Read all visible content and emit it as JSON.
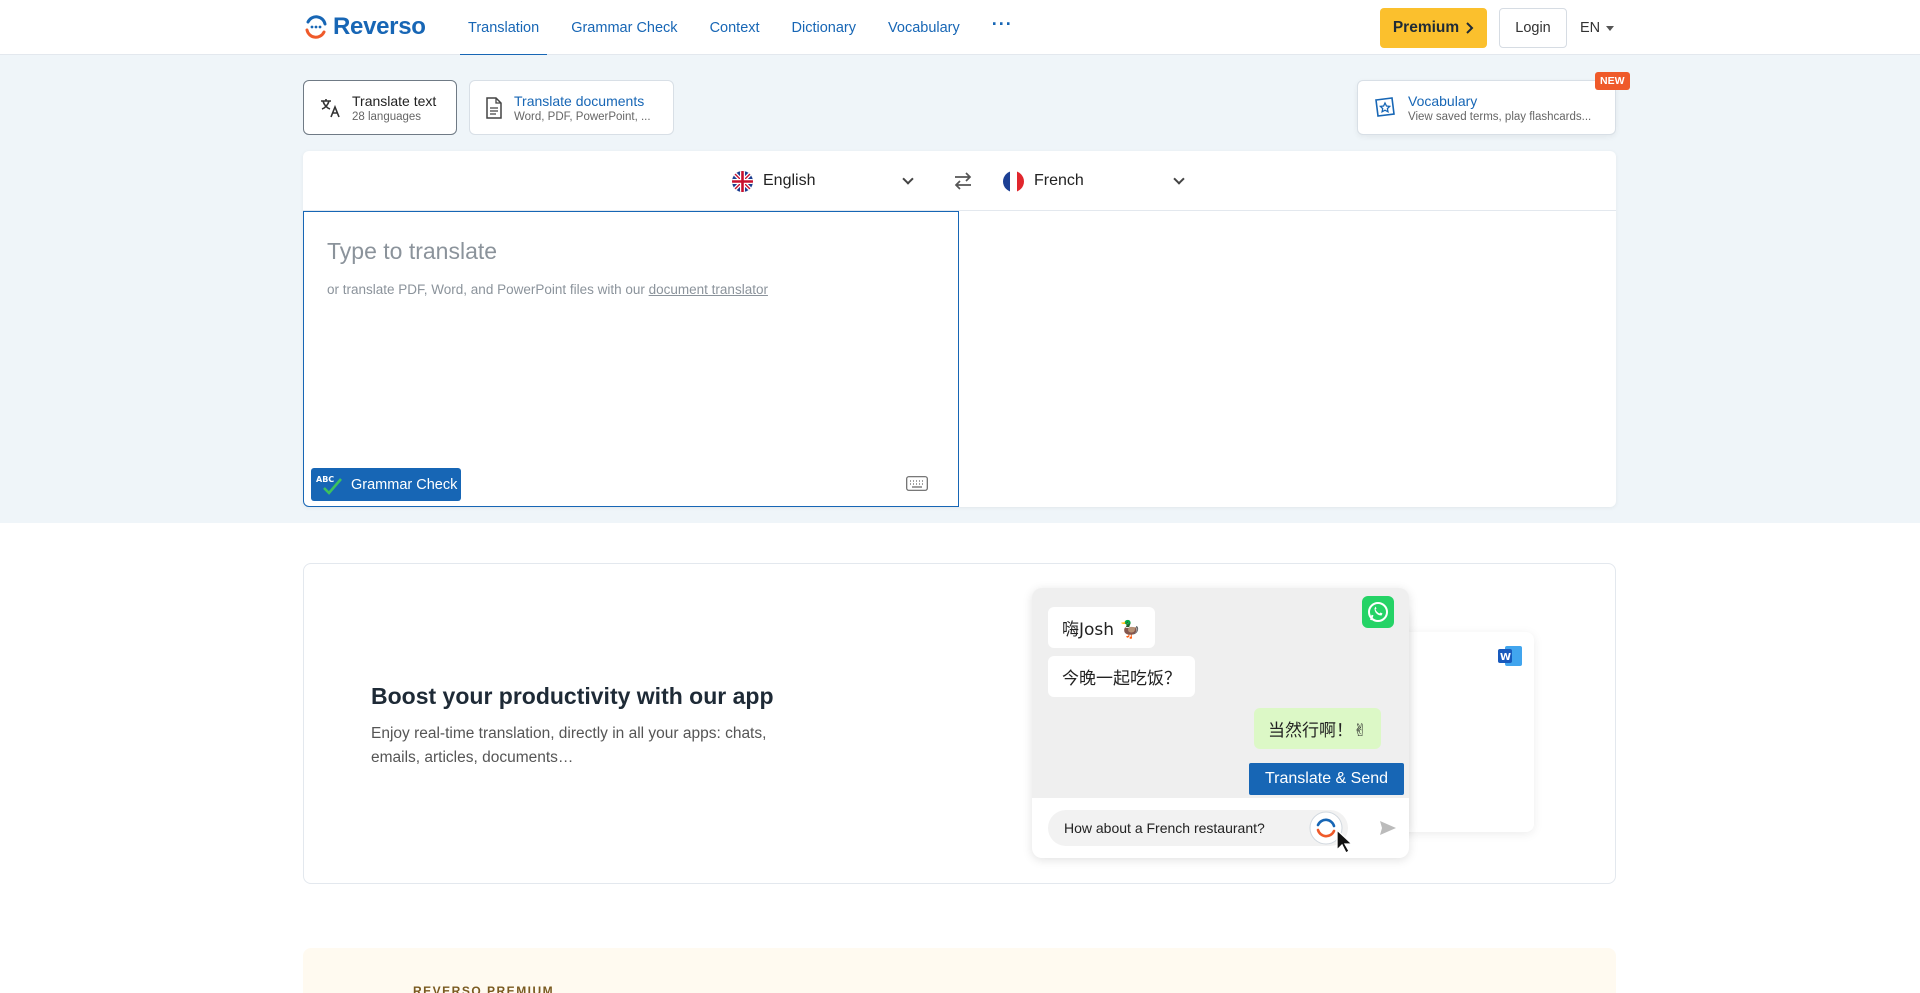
{
  "brand": {
    "name": "Reverso"
  },
  "nav": {
    "items": [
      {
        "label": "Translation",
        "active": true
      },
      {
        "label": "Grammar Check",
        "active": false
      },
      {
        "label": "Context",
        "active": false
      },
      {
        "label": "Dictionary",
        "active": false
      },
      {
        "label": "Vocabulary",
        "active": false
      }
    ],
    "more": "···"
  },
  "header": {
    "premium_label": "Premium",
    "login_label": "Login",
    "ui_language": "EN"
  },
  "modes": {
    "text": {
      "title": "Translate text",
      "subtitle": "28 languages"
    },
    "documents": {
      "title": "Translate documents",
      "subtitle": "Word, PDF, PowerPoint, ..."
    }
  },
  "vocabulary_card": {
    "title": "Vocabulary",
    "subtitle": "View saved terms, play flashcards...",
    "badge": "NEW"
  },
  "translator": {
    "source_language": "English",
    "target_language": "French",
    "placeholder": "Type to translate",
    "hint_prefix": "or translate PDF, Word, and PowerPoint files with our ",
    "hint_link": "document translator",
    "grammar_check_label": "Grammar Check",
    "grammar_badge": "ABC"
  },
  "promo": {
    "title": "Boost your productivity with our app",
    "subtitle": "Enjoy real-time translation, directly in all your apps: chats, emails, articles, documents…",
    "chat": {
      "messages": [
        {
          "text": "嗨Josh 🦆",
          "mine": false
        },
        {
          "text": "今晚一起吃饭？",
          "mine": false
        },
        {
          "text": "当然行啊！✌",
          "mine": true
        }
      ],
      "input_value": "How about a French restaurant?",
      "action_label": "Translate & Send"
    }
  },
  "premium_strip": {
    "label": "REVERSO PREMIUM"
  },
  "colors": {
    "accent": "#1766b5",
    "premium": "#fbc02d",
    "badge": "#ef5a2a"
  }
}
